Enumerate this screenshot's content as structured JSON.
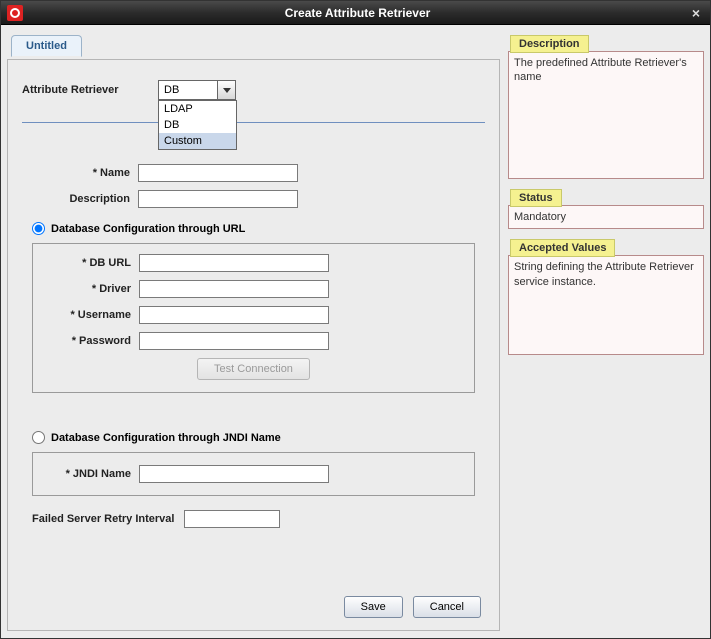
{
  "window": {
    "title": "Create Attribute Retriever"
  },
  "tab": {
    "label": "Untitled"
  },
  "form": {
    "retriever_label": "Attribute Retriever",
    "retriever_value": "DB",
    "retriever_options": [
      "LDAP",
      "DB",
      "Custom"
    ],
    "name_label": "* Name",
    "name_value": "",
    "desc_label": "Description",
    "desc_value": "",
    "radio_url_label": "Database Configuration through URL",
    "db_url_label": "* DB URL",
    "db_url_value": "",
    "driver_label": "* Driver",
    "driver_value": "",
    "username_label": "* Username",
    "username_value": "",
    "password_label": "* Password",
    "password_value": "",
    "test_btn": "Test Connection",
    "radio_jndi_label": "Database Configuration through JNDI Name",
    "jndi_label": "* JNDI Name",
    "jndi_value": "",
    "retry_label": "Failed Server Retry Interval",
    "retry_value": ""
  },
  "buttons": {
    "save": "Save",
    "cancel": "Cancel"
  },
  "info": {
    "description_title": "Description",
    "description_body": "The predefined Attribute Retriever's name",
    "status_title": "Status",
    "status_body": "Mandatory",
    "accepted_title": "Accepted Values",
    "accepted_body": "String defining the Attribute Retriever service instance."
  }
}
